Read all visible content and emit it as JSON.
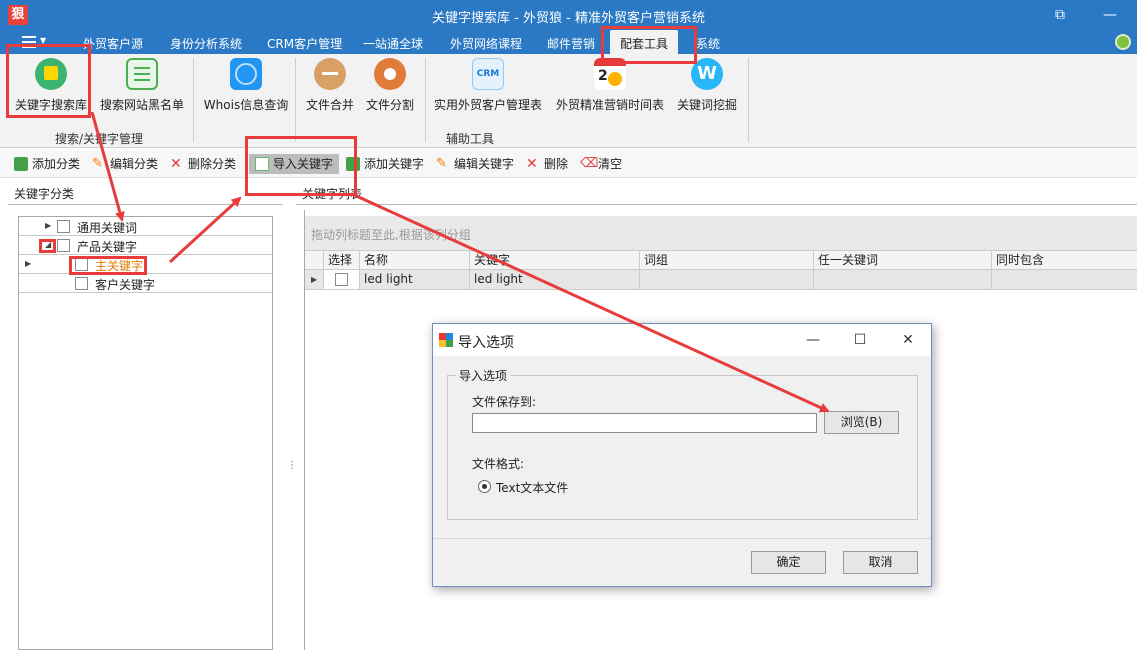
{
  "window": {
    "logo_text": "狠",
    "title": "关键字搜索库 - 外贸狼 - 精准外贸客户营销系统"
  },
  "tabs": [
    {
      "label": "外贸客户源"
    },
    {
      "label": "身份分析系统"
    },
    {
      "label": "CRM客户管理"
    },
    {
      "label": "一站通全球"
    },
    {
      "label": "外贸网络课程"
    },
    {
      "label": "邮件营销"
    },
    {
      "label": "配套工具"
    },
    {
      "label": "系统"
    }
  ],
  "ribbon": {
    "buttons": [
      {
        "label": "关键字搜索库",
        "icon": "shopping-bag-icon"
      },
      {
        "label": "搜索网站黑名单",
        "icon": "checklist-icon"
      },
      {
        "label": "Whois信息查询",
        "icon": "globe-icon"
      },
      {
        "label": "文件合并",
        "icon": "file-merge-icon"
      },
      {
        "label": "文件分割",
        "icon": "file-split-icon"
      },
      {
        "label": "实用外贸客户管理表",
        "icon": "crm-icon"
      },
      {
        "label": "外贸精准营销时间表",
        "icon": "calendar-clock-icon"
      },
      {
        "label": "关键词挖掘",
        "icon": "w-logo-icon"
      }
    ],
    "groups": [
      {
        "label": "搜索/关键字管理"
      },
      {
        "label": "辅助工具"
      }
    ]
  },
  "toolbar": {
    "items": [
      {
        "label": "添加分类"
      },
      {
        "label": "编辑分类"
      },
      {
        "label": "删除分类"
      },
      {
        "label": "导入关键字"
      },
      {
        "label": "添加关键字"
      },
      {
        "label": "编辑关键字"
      },
      {
        "label": "删除"
      },
      {
        "label": "清空"
      }
    ]
  },
  "left_pane": {
    "title": "关键字分类",
    "tree": [
      {
        "label": "通用关键词"
      },
      {
        "label": "产品关键字"
      },
      {
        "label": "主关键字"
      },
      {
        "label": "客户关键字"
      }
    ]
  },
  "right_pane": {
    "tab": "关键字列表",
    "group_hint": "拖动列标题至此,根据该列分组",
    "columns": [
      "选择",
      "名称",
      "关键字",
      "词组",
      "任一关键词",
      "同时包含"
    ],
    "rows": [
      {
        "name": "led light",
        "keyword": "led light",
        "phrase": "",
        "any": "",
        "all": ""
      }
    ]
  },
  "dialog": {
    "title": "导入选项",
    "group_label": "导入选项",
    "save_label": "文件保存到:",
    "path_value": "",
    "browse_label": "浏览(B)",
    "format_label": "文件格式:",
    "format_option": "Text文本文件",
    "ok_label": "确定",
    "cancel_label": "取消"
  },
  "annotation_color": "#e83b3b"
}
